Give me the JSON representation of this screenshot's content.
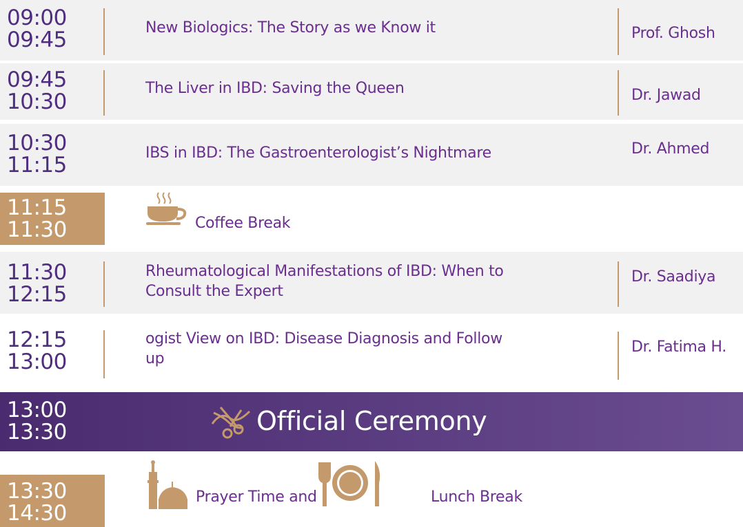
{
  "sessions": [
    {
      "start": "09:00",
      "end": "09:45",
      "title_lines": [
        "New Biologics: The Story as we Know it"
      ],
      "speaker": "Prof. Ghosh"
    },
    {
      "start": "09:45",
      "end": "10:30",
      "title_lines": [
        "The Liver in IBD: Saving the Queen"
      ],
      "speaker": "Dr. Jawad"
    },
    {
      "start": "10:30",
      "end": "11:15",
      "title_lines": [
        "IBS in IBD: The Gastroenterologist’s Nightmare"
      ],
      "speaker": "Dr. Ahmed"
    },
    {
      "start": "11:30",
      "end": "12:15",
      "title_lines": [
        "Rheumatological Manifestations of IBD: When to",
        "Consult the Expert"
      ],
      "speaker": "Dr. Saadiya"
    },
    {
      "start": "12:15",
      "end": "13:00",
      "title_lines": [
        "ogist View on IBD: Disease Diagnosis and Follow",
        "up"
      ],
      "speaker": "Dr. Fatima H."
    }
  ],
  "coffee_break": {
    "start": "11:15",
    "end": "11:30",
    "label": "Coffee Break",
    "icon": "coffee-cup-icon"
  },
  "ceremony": {
    "start": "13:00",
    "end": "13:30",
    "label": "Official Ceremony",
    "icon": "ribbon-scissors-icon"
  },
  "prayer_lunch": {
    "start": "13:30",
    "end": "14:30",
    "prayer_label": "Prayer Time and",
    "lunch_label": "Lunch Break",
    "prayer_icon": "mosque-icon",
    "lunch_icon": "plate-cutlery-icon"
  },
  "colors": {
    "purple": "#6a2e8f",
    "dark_purple": "#4f2d7f",
    "gold": "#c49a6c",
    "row_shade": "#f1f1f2"
  }
}
